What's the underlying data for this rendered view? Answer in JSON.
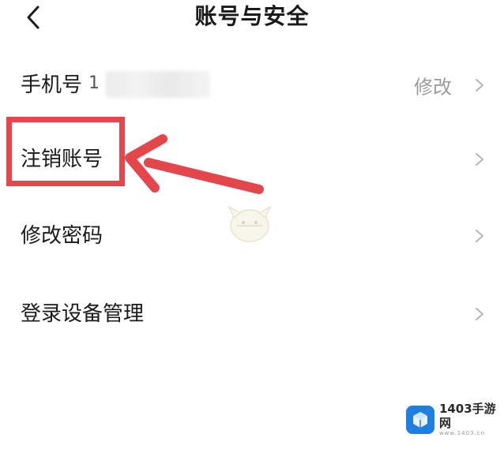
{
  "header": {
    "back_icon": "chevron-left-icon",
    "title": "账号与安全"
  },
  "rows": [
    {
      "label": "手机号",
      "value": "修改",
      "masked_digit": "1",
      "icon": "chevron-right-icon"
    },
    {
      "label": "注销账号",
      "icon": "chevron-right-icon"
    },
    {
      "label": "修改密码",
      "icon": "chevron-right-icon"
    },
    {
      "label": "登录设备管理",
      "icon": "chevron-right-icon"
    }
  ],
  "annotation": {
    "highlight_color": "#e4474b",
    "arrow_color": "#e4474b"
  },
  "watermark": {
    "name": "1403手游网",
    "url": "www.1403.cn",
    "logo_color": "#1f7fe0"
  },
  "colors": {
    "text": "#1a1a1a",
    "secondary_text": "#9b9b9b",
    "chevron": "#b5b5b5"
  }
}
